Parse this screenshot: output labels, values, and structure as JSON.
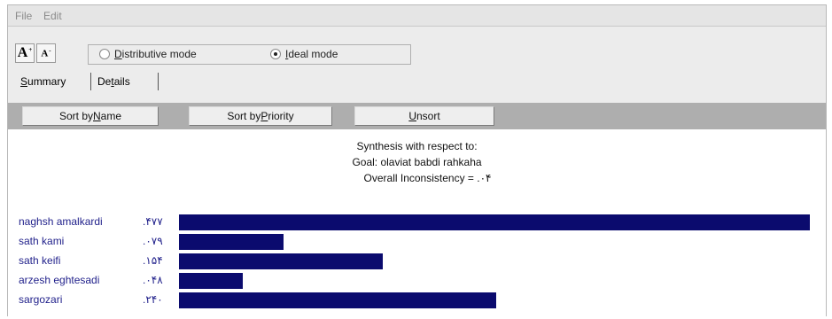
{
  "menu": {
    "file": "File",
    "edit": "Edit"
  },
  "toolbar": {
    "font_larger_icon": "font-increase-icon",
    "font_smaller_icon": "font-decrease-icon",
    "font_larger_glyph": "A",
    "font_smaller_glyph": "A",
    "modes": [
      {
        "label_pre": "",
        "label_key": "D",
        "label_post": "istributive mode",
        "selected": false
      },
      {
        "label_pre": "",
        "label_key": "I",
        "label_post": "deal mode",
        "selected": true
      }
    ]
  },
  "tabs": [
    {
      "key": "S",
      "rest": "ummary"
    },
    {
      "pre": "De",
      "key": "t",
      "rest": "ails"
    }
  ],
  "buttons": {
    "sort_name": {
      "pre": "Sort by ",
      "key": "N",
      "post": "ame"
    },
    "sort_priority": {
      "pre": "Sort by ",
      "key": "P",
      "post": "riority"
    },
    "unsort": {
      "pre": "",
      "key": "U",
      "post": "nsort"
    }
  },
  "synthesis": {
    "line1": "Synthesis with respect to:",
    "line2": "Goal: olaviat babdi rahkaha",
    "line3": "Overall Inconsistency = .۰۴"
  },
  "colors": {
    "bar": "#0b0b6e",
    "label": "#1f1f8a",
    "button_bar": "#aeaeae"
  },
  "chart_data": {
    "type": "bar",
    "orientation": "horizontal",
    "categories": [
      "naghsh amalkardi",
      "sath kami",
      "sath keifi",
      "arzesh eghtesadi",
      "sargozari"
    ],
    "value_labels": [
      ".۴۷۷",
      ".۰۷۹",
      ".۱۵۴",
      ".۰۴۸",
      ".۲۴۰"
    ],
    "values": [
      0.477,
      0.079,
      0.154,
      0.048,
      0.24
    ],
    "xlim": [
      0,
      0.477
    ]
  }
}
